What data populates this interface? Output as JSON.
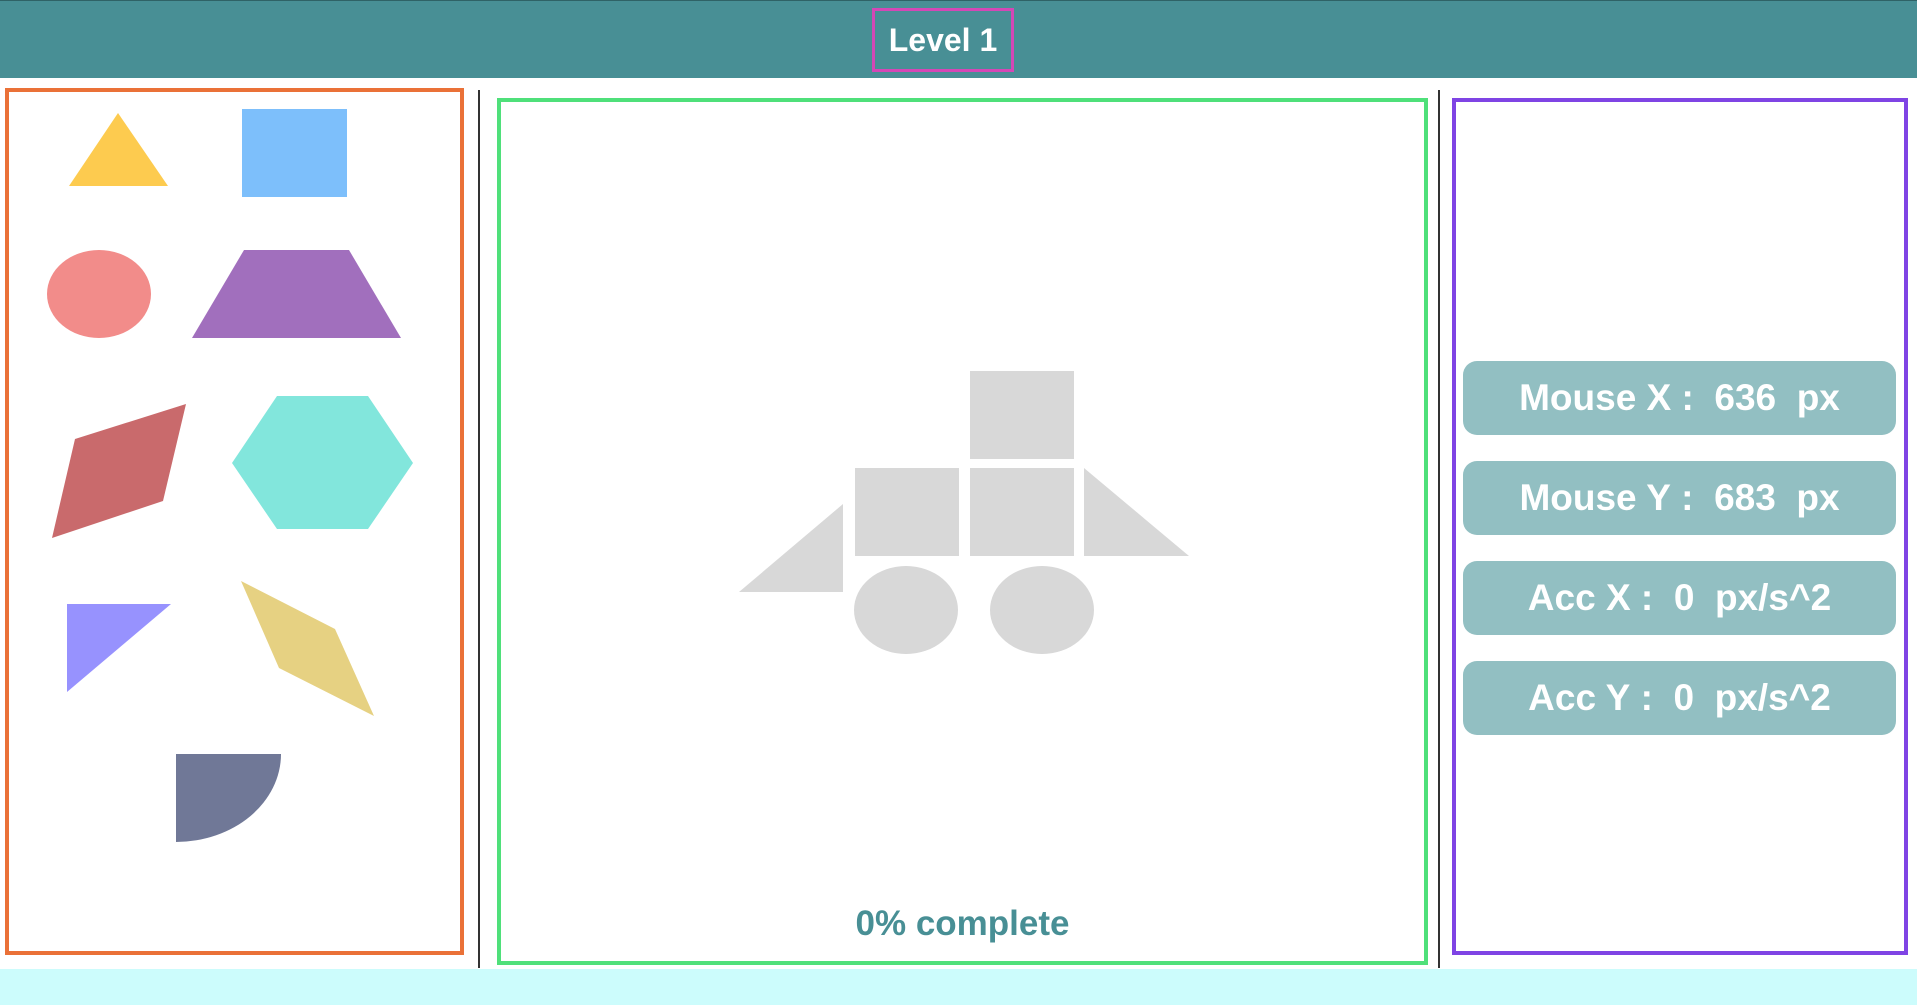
{
  "header": {
    "title": "Level 1"
  },
  "palette": {
    "shapes": [
      {
        "name": "triangle",
        "color": "#fdcb4f"
      },
      {
        "name": "square",
        "color": "#7dbffb"
      },
      {
        "name": "ellipse",
        "color": "#f28c8a"
      },
      {
        "name": "trapezoid",
        "color": "#a16fbd"
      },
      {
        "name": "parallelogram",
        "color": "#c96a6c"
      },
      {
        "name": "hexagon",
        "color": "#82e6dc"
      },
      {
        "name": "right-triangle",
        "color": "#9792fe"
      },
      {
        "name": "rhombus",
        "color": "#e6d182"
      },
      {
        "name": "quarter-circle",
        "color": "#707897"
      }
    ]
  },
  "board": {
    "target_color": "#d8d8d8",
    "progress_label": "0% complete"
  },
  "stats": [
    {
      "label": "Mouse X",
      "value": "636",
      "unit": "px"
    },
    {
      "label": "Mouse Y",
      "value": "683",
      "unit": "px"
    },
    {
      "label": "Acc X",
      "value": "0",
      "unit": "px/s^2"
    },
    {
      "label": "Acc Y",
      "value": "0",
      "unit": "px/s^2"
    }
  ],
  "colors": {
    "header_bg": "#488f95",
    "title_border": "#d447b6",
    "palette_border": "#ea7138",
    "board_border": "#4fe07a",
    "stats_border": "#7f44e4",
    "stat_bg": "#92bfc2",
    "footer_bg": "#ccfcfc"
  }
}
